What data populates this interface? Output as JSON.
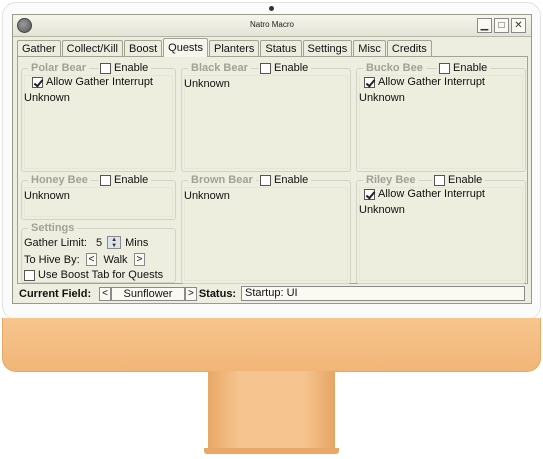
{
  "window": {
    "title": "Natro Macro"
  },
  "tabs": [
    {
      "label": "Gather"
    },
    {
      "label": "Collect/Kill"
    },
    {
      "label": "Boost"
    },
    {
      "label": "Quests",
      "active": true
    },
    {
      "label": "Planters"
    },
    {
      "label": "Status"
    },
    {
      "label": "Settings"
    },
    {
      "label": "Misc"
    },
    {
      "label": "Credits"
    }
  ],
  "quests": {
    "polar_bear": {
      "title": "Polar Bear",
      "enable_label": "Enable",
      "enabled": false,
      "allow_label": "Allow Gather Interrupt",
      "allow_checked": true,
      "status": "Unknown"
    },
    "black_bear": {
      "title": "Black Bear",
      "enable_label": "Enable",
      "enabled": false,
      "status": "Unknown"
    },
    "bucko_bee": {
      "title": "Bucko Bee",
      "enable_label": "Enable",
      "enabled": false,
      "allow_label": "Allow Gather Interrupt",
      "allow_checked": true,
      "status": "Unknown"
    },
    "honey_bee": {
      "title": "Honey Bee",
      "enable_label": "Enable",
      "enabled": false,
      "status": "Unknown"
    },
    "brown_bear": {
      "title": "Brown Bear",
      "enable_label": "Enable",
      "enabled": false,
      "status": "Unknown"
    },
    "riley_bee": {
      "title": "Riley Bee",
      "enable_label": "Enable",
      "enabled": false,
      "allow_label": "Allow Gather Interrupt",
      "allow_checked": true,
      "status": "Unknown"
    }
  },
  "settings": {
    "title": "Settings",
    "gather_limit_label": "Gather Limit:",
    "gather_limit_value": "5",
    "gather_limit_unit": "Mins",
    "to_hive_label": "To Hive By:",
    "to_hive_value": "Walk",
    "boost_tab_label": "Use Boost Tab for Quests",
    "boost_tab_checked": false
  },
  "bottom": {
    "current_field_label": "Current Field:",
    "current_field_value": "Sunflower",
    "prev_symbol": "<",
    "next_symbol": ">",
    "status_label": "Status:",
    "status_value": "Startup: UI"
  }
}
